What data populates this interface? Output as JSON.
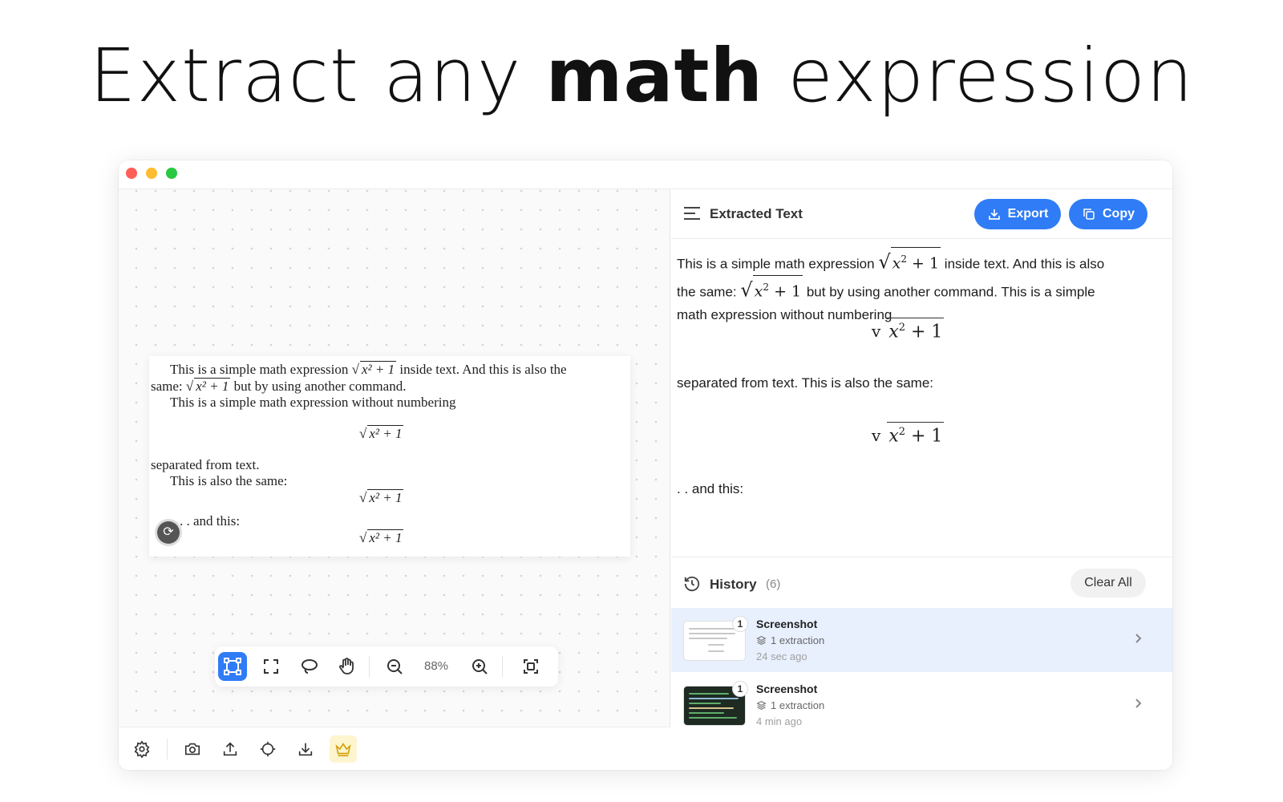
{
  "headline": {
    "part1": "Extract any ",
    "bold": "math",
    "part2": " expression"
  },
  "canvas": {
    "document_lines": {
      "l1_a": "This is a simple math expression ",
      "l1_sqrt": "x² + 1",
      "l1_b": " inside text.  And this is also the",
      "l2_a": "same: ",
      "l2_sqrt": "x² + 1",
      "l2_b": " but by using another command.",
      "l3": "This is a simple math expression without numbering",
      "eq1": "x² + 1",
      "l4": "separated from text.",
      "l5": "This is also the same:",
      "eq2": "x² + 1",
      "l6": ". . and this:",
      "eq3": "x² + 1"
    },
    "toolbar": {
      "zoom": "88%",
      "tools": [
        "select-region-icon",
        "fullscreen-select-icon",
        "lasso-icon",
        "hand-icon",
        "zoom-out-icon",
        "zoom-in-icon",
        "fit-screen-icon"
      ]
    },
    "bottom_icons": [
      "settings-icon",
      "camera-icon",
      "upload-icon",
      "crosshair-icon",
      "download-icon",
      "crown-icon"
    ]
  },
  "panel": {
    "title": "Extracted Text",
    "export_label": "Export",
    "copy_label": "Copy",
    "accent_color": "#2f7cf6",
    "text": {
      "p1_a": "This is a simple math expression ",
      "p1_math": "x",
      "p1_sup": "2",
      "p1_tail": " + 1",
      "p1_b": " inside text. And this is also",
      "p2_a": "the same: ",
      "p2_math": "x",
      "p2_sup": "2",
      "p2_tail": " + 1",
      "p2_b": " but by using another command. This is a simple",
      "p3": "math expression without numbering",
      "disp1_v": "v",
      "disp1_x": "x",
      "disp1_sup": "2",
      "disp1_tail": " + 1",
      "p4": "separated from text. This is also the same:",
      "disp2_v": "v",
      "disp2_x": "x",
      "disp2_sup": "2",
      "disp2_tail": " + 1",
      "p5": ". . and this:"
    },
    "history": {
      "title": "History",
      "count": "(6)",
      "clear_label": "Clear All",
      "items": [
        {
          "badge": "1",
          "name": "Screenshot",
          "extractions": "1 extraction",
          "time": "24 sec ago"
        },
        {
          "badge": "1",
          "name": "Screenshot",
          "extractions": "1 extraction",
          "time": "4 min ago"
        }
      ]
    }
  }
}
